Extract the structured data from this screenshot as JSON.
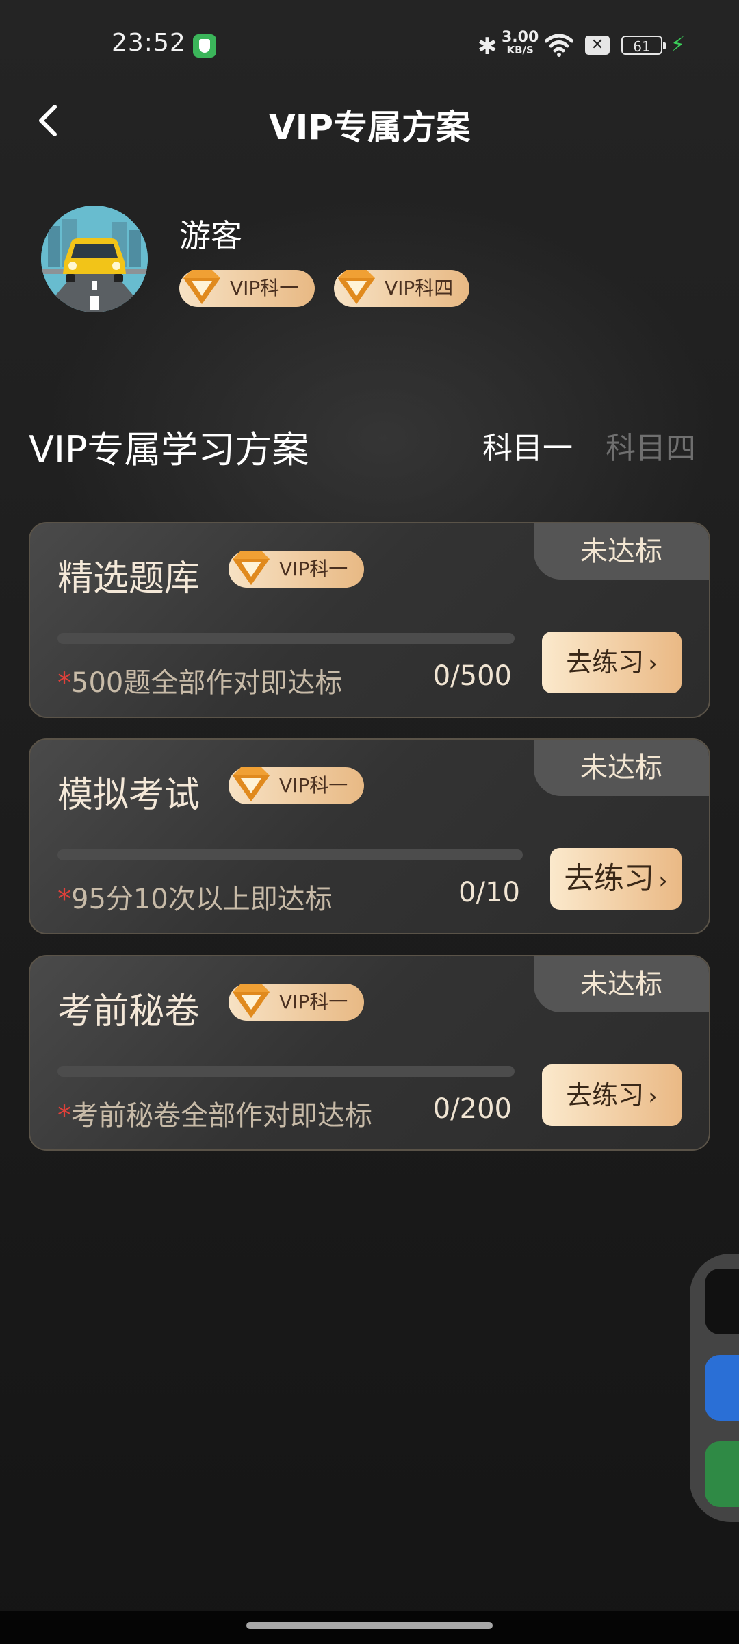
{
  "status_bar": {
    "time": "23:52",
    "speed_value": "3.00",
    "speed_unit": "KB/S",
    "battery": "61"
  },
  "header": {
    "title": "VIP专属方案"
  },
  "profile": {
    "name": "游客",
    "badges": [
      "VIP科一",
      "VIP科四"
    ]
  },
  "section": {
    "title": "VIP专属学习方案",
    "tabs": [
      {
        "label": "科目一",
        "active": true
      },
      {
        "label": "科目四",
        "active": false
      }
    ]
  },
  "cards": [
    {
      "title": "精选题库",
      "badge": "VIP科一",
      "status": "未达标",
      "requirement_mark": "*",
      "requirement": "500题全部作对即达标",
      "count": "0/500",
      "progress": 0,
      "button": "去练习"
    },
    {
      "title": "模拟考试",
      "badge": "VIP科一",
      "status": "未达标",
      "requirement_mark": "*",
      "requirement": "95分10次以上即达标",
      "count": "0/10",
      "progress": 0,
      "button": "去练习"
    },
    {
      "title": "考前秘卷",
      "badge": "VIP科一",
      "status": "未达标",
      "requirement_mark": "*",
      "requirement": "考前秘卷全部作对即达标",
      "count": "0/200",
      "progress": 0,
      "button": "去练习"
    }
  ],
  "colors": {
    "accent_gold": "#e8b984",
    "status_red_star": "#e0403a",
    "background": "#1e1e1e"
  }
}
